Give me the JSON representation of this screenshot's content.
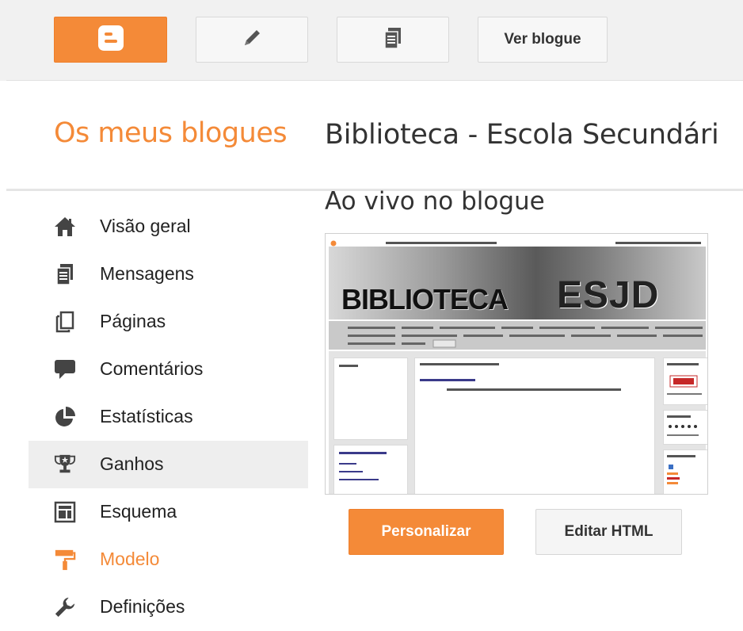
{
  "toolbar": {
    "blogger_icon": "blogger-logo-icon",
    "edit_icon": "pencil-icon",
    "posts_icon": "posts-icon",
    "view_blog_label": "Ver blogue"
  },
  "header": {
    "my_blogs": "Os meus blogues",
    "blog_title": "Biblioteca - Escola Secundári"
  },
  "sidebar": {
    "items": [
      {
        "label": "Visão geral",
        "icon": "home-icon"
      },
      {
        "label": "Mensagens",
        "icon": "posts-icon"
      },
      {
        "label": "Páginas",
        "icon": "page-icon"
      },
      {
        "label": "Comentários",
        "icon": "comment-icon"
      },
      {
        "label": "Estatísticas",
        "icon": "pie-chart-icon"
      },
      {
        "label": "Ganhos",
        "icon": "trophy-icon"
      },
      {
        "label": "Esquema",
        "icon": "layout-icon"
      },
      {
        "label": "Modelo",
        "icon": "paint-roller-icon"
      },
      {
        "label": "Definições",
        "icon": "wrench-icon"
      }
    ],
    "active_item": "Modelo"
  },
  "main": {
    "live_title": "Ao vivo no blogue",
    "preview": {
      "banner_word1": "BIBLIOTECA",
      "banner_word2": "ESJD"
    },
    "customize_label": "Personalizar",
    "edit_html_label": "Editar HTML"
  },
  "colors": {
    "accent": "#f48a38",
    "toolbar_bg": "#f1f1f1",
    "hover_bg": "#eeeeee"
  }
}
